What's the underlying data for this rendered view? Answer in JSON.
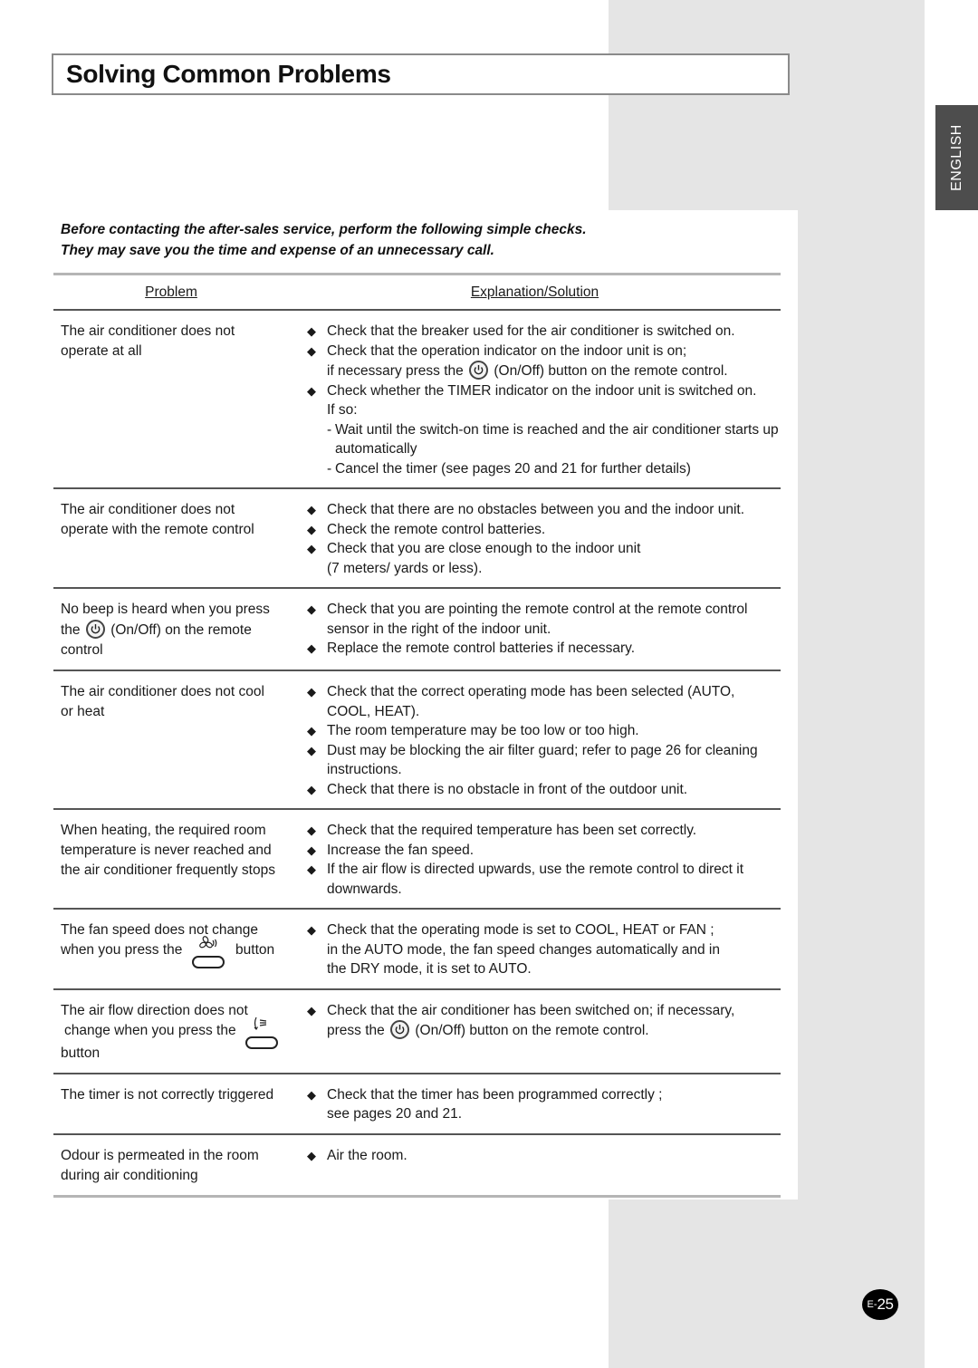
{
  "page": {
    "title": "Solving Common Problems",
    "language_tab": "ENGLISH",
    "page_number_prefix": "E-",
    "page_number": "25"
  },
  "intro": {
    "line1": "Before contacting the after-sales service, perform the following simple checks.",
    "line2": "They may save you the time and expense of an unnecessary call."
  },
  "table": {
    "headers": {
      "problem": "Problem",
      "solution": "Explanation/Solution"
    },
    "rows": [
      {
        "problem": [
          "The air conditioner does not",
          "operate at all"
        ],
        "solution": {
          "b1": "Check that the breaker used for the air conditioner is switched on.",
          "b2": "Check that the operation indicator on the indoor unit is on;",
          "b2_cont_pre": "if necessary press the",
          "b2_cont_post": "(On/Off) button on the remote control.",
          "b3": "Check whether the TIMER indicator on the indoor unit is switched on.",
          "b3_cont": "If so:",
          "sub1": "Wait until the switch-on time is reached and the air conditioner starts up automatically",
          "sub2": "Cancel the timer (see pages 20 and 21 for further details)"
        }
      },
      {
        "problem": [
          "The air conditioner does not",
          "operate with the remote control"
        ],
        "solution": {
          "b1": "Check that there are no obstacles between you and the indoor unit.",
          "b2": "Check the remote control batteries.",
          "b3": "Check that you are close enough to the indoor unit",
          "b3_cont": "(7 meters/ yards or less)."
        }
      },
      {
        "problem": {
          "l1": "No beep is heard when you press",
          "l2_pre": "the",
          "l2_post": "(On/Off) on the remote",
          "l3": "control"
        },
        "solution": {
          "b1": "Check that you are pointing the remote control at the remote control",
          "b1_cont": "sensor in the right of the indoor unit.",
          "b2": "Replace the remote control batteries if necessary."
        }
      },
      {
        "problem": [
          "The air conditioner does not cool",
          "or heat"
        ],
        "solution": {
          "b1": "Check that the correct operating mode has been selected (AUTO,",
          "b1_cont": "COOL, HEAT).",
          "b2": "The room temperature may be too low or too high.",
          "b3": "Dust may be blocking the air filter guard; refer to page 26 for cleaning",
          "b3_cont": "instructions.",
          "b4": "Check that there is no obstacle in front of the outdoor unit."
        }
      },
      {
        "problem": [
          "When heating, the required room",
          "temperature is never reached and",
          "the air conditioner frequently stops"
        ],
        "solution": {
          "b1": "Check that the required temperature has been set correctly.",
          "b2": "Increase the fan speed.",
          "b3": "If the air flow is directed upwards, use the remote control to direct it",
          "b3_cont": "downwards."
        }
      },
      {
        "problem": {
          "l1": "The fan speed does not change",
          "l2_pre": "when you press the",
          "l2_post": "button"
        },
        "solution": {
          "b1": "Check that the operating mode is set to COOL, HEAT or FAN ;",
          "b1_cont1": "in the AUTO mode, the fan speed changes automatically and in",
          "b1_cont2": "the DRY mode, it is set to AUTO."
        }
      },
      {
        "problem": {
          "l1": "The air flow direction does not",
          "l2_pre": "change when you press the",
          "l3": "button"
        },
        "solution": {
          "b1": "Check that the air conditioner has been switched on; if necessary,",
          "b1_cont_pre": "press the",
          "b1_cont_post": "(On/Off) button on the remote control."
        }
      },
      {
        "problem": [
          "The timer is not correctly triggered"
        ],
        "solution": {
          "b1": "Check that the timer has been programmed correctly ;",
          "b1_cont": "see pages 20 and 21."
        }
      },
      {
        "problem": [
          "Odour is permeated in the room",
          "during air conditioning"
        ],
        "solution": {
          "b1": "Air the room."
        }
      }
    ]
  },
  "icons": {
    "bullet": "◆"
  }
}
